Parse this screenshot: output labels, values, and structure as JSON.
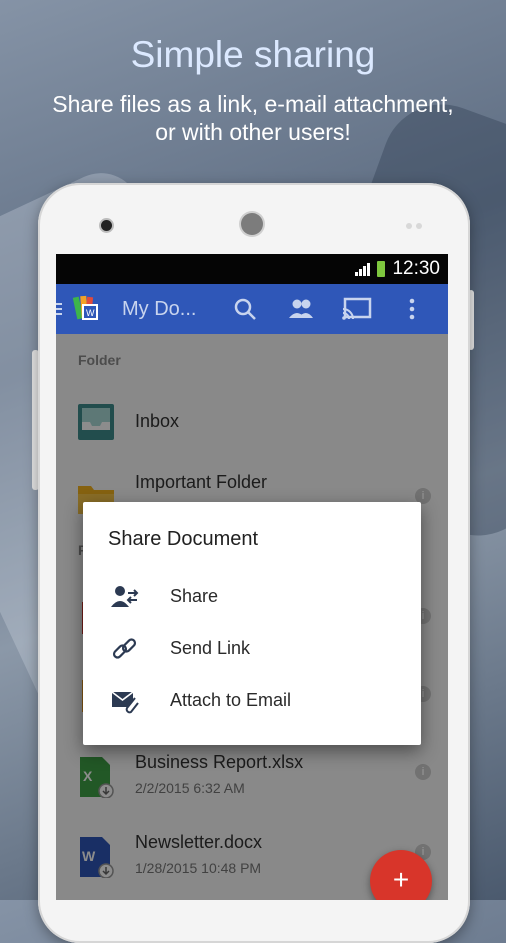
{
  "promo": {
    "headline": "Simple sharing",
    "subline_1": "Share files as a link, e-mail attachment,",
    "subline_2": "or with other users!"
  },
  "status_bar": {
    "time": "12:30",
    "battery_color": "#7ec73e"
  },
  "app_bar": {
    "title": "My Do...",
    "color": "#2f57b8",
    "icons": [
      "menu-icon",
      "app-logo-icon",
      "search-icon",
      "users-icon",
      "cast-icon",
      "overflow-icon"
    ]
  },
  "list": {
    "section_folder": "Folder",
    "section_files_partial": "F",
    "folders": [
      {
        "name": "Inbox",
        "icon": "inbox-icon"
      },
      {
        "name": "Important Folder",
        "icon": "folder-icon"
      }
    ],
    "files": [
      {
        "name": "Business Report.xlsx",
        "meta": "2/2/2015  6:32 AM",
        "icon": "excel-file-icon"
      },
      {
        "name": "Newsletter.docx",
        "meta": "1/28/2015 10:48 PM",
        "icon": "word-file-icon"
      }
    ]
  },
  "dialog": {
    "title": "Share Document",
    "items": [
      {
        "label": "Share",
        "icon": "share-users-icon"
      },
      {
        "label": "Send Link",
        "icon": "link-icon"
      },
      {
        "label": "Attach to Email",
        "icon": "attach-email-icon"
      }
    ]
  },
  "fab": {
    "label": "+",
    "color": "#d8352a"
  }
}
